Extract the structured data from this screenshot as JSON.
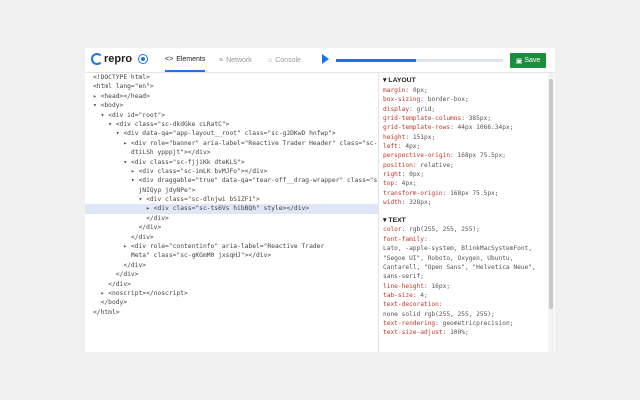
{
  "toolbar": {
    "logo_text": "repro",
    "tabs": [
      {
        "label": "Elements",
        "icon": "<>",
        "active": true
      },
      {
        "label": "Network",
        "icon": "≡",
        "active": false
      },
      {
        "label": "Console",
        "icon": "⌂",
        "active": false
      }
    ],
    "save_label": "Save",
    "playback_progress": 0.48,
    "accent": "#1a73e8",
    "save_color": "#1d8c3c"
  },
  "dom_lines": [
    {
      "text": "<!DOCTYPE html>",
      "selected": false
    },
    {
      "text": "<html lang=\"en\">",
      "selected": false
    },
    {
      "text": "▸ <head></head>",
      "selected": false
    },
    {
      "text": "▾ <body>",
      "selected": false
    },
    {
      "text": "  ▾ <div id=\"root\">",
      "selected": false
    },
    {
      "text": "    ▾ <div class=\"sc-dkdGke cLRatC\">",
      "selected": false
    },
    {
      "text": "      ▾ <div data-qa=\"app-layout__root\" class=\"sc-gJDKwD hnfwp\">",
      "selected": false
    },
    {
      "text": "        ▸ <div role=\"banner\" aria-label=\"Reactive Trader Header\" class=\"sc-",
      "selected": false
    },
    {
      "text": "          dtiLSh ypppjt\"></div>",
      "selected": false
    },
    {
      "text": "        ▾ <div class=\"sc-fjjiKk dteKLS\">",
      "selected": false
    },
    {
      "text": "          ▸ <div class=\"sc-imLK bvMJFo\"></div>",
      "selected": false
    },
    {
      "text": "          ▾ <div draggable=\"true\" data-qa=\"tear-off__drag-wrapper\" class=\"sc-",
      "selected": false
    },
    {
      "text": "            jNIQyp jdyNPe\">",
      "selected": false
    },
    {
      "text": "            ▾ <div class=\"sc-dlnjwi bS1ZF1\">",
      "selected": false
    },
    {
      "text": "              ▸ <div class=\"sc-ts6Vs hibBQh\" style></div>",
      "selected": true
    },
    {
      "text": "              </div>",
      "selected": false
    },
    {
      "text": "            </div>",
      "selected": false
    },
    {
      "text": "          </div>",
      "selected": false
    },
    {
      "text": "        ▸ <div role=\"contentinfo\" aria-label=\"Reactive Trader",
      "selected": false
    },
    {
      "text": "          Meta\" class=\"sc-gKGmM0 jxsqHJ\"></div>",
      "selected": false
    },
    {
      "text": "        </div>",
      "selected": false
    },
    {
      "text": "      </div>",
      "selected": false
    },
    {
      "text": "    </div>",
      "selected": false
    },
    {
      "text": "  ▸ <noscript></noscript>",
      "selected": false
    },
    {
      "text": "  </body>",
      "selected": false
    },
    {
      "text": "</html>",
      "selected": false
    }
  ],
  "styles": {
    "layout_title": "LAYOUT",
    "layout": [
      {
        "name": "margin",
        "value": "0px;"
      },
      {
        "name": "box-sizing",
        "value": "border-box;"
      },
      {
        "name": "display",
        "value": "grid;"
      },
      {
        "name": "grid-template-columns",
        "value": "385px;"
      },
      {
        "name": "grid-template-rows",
        "value": "44px 1066.34px;"
      },
      {
        "name": "height",
        "value": "151px;"
      },
      {
        "name": "left",
        "value": "4px;"
      },
      {
        "name": "perspective-origin",
        "value": "168px 75.5px;"
      },
      {
        "name": "position",
        "value": "relative;"
      },
      {
        "name": "right",
        "value": "0px;"
      },
      {
        "name": "top",
        "value": "4px;"
      },
      {
        "name": "transform-origin",
        "value": "168px 75.5px;"
      },
      {
        "name": "width",
        "value": "328px;"
      }
    ],
    "text_title": "TEXT",
    "text": [
      {
        "name": "color",
        "value": "rgb(255, 255, 255);"
      },
      {
        "name": "font-family",
        "value": ""
      },
      {
        "name": "",
        "value": " Lato, -apple-system, BlinkMacSystemFont,"
      },
      {
        "name": "",
        "value": " \"Segoe UI\", Roboto, Oxygen, Ubuntu,"
      },
      {
        "name": "",
        "value": " Cantarell, \"Open Sans\", \"Helvetica Neue\","
      },
      {
        "name": "",
        "value": " sans-serif;"
      },
      {
        "name": "line-height",
        "value": "16px;"
      },
      {
        "name": "tab-size",
        "value": "4;"
      },
      {
        "name": "text-decoration",
        "value": ""
      },
      {
        "name": "",
        "value": " none solid rgb(255, 255, 255);"
      },
      {
        "name": "text-rendering",
        "value": "geometricprecision;"
      },
      {
        "name": "text-size-adjust",
        "value": "100%;"
      }
    ]
  }
}
